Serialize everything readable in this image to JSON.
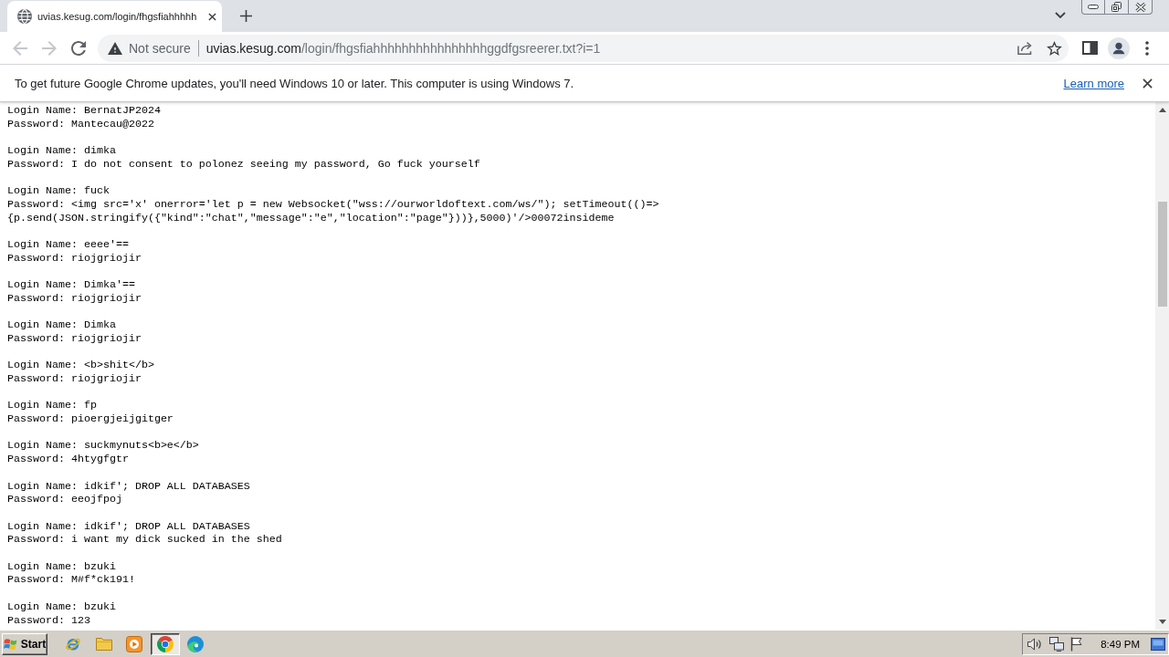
{
  "tabstrip": {
    "tabs": [
      {
        "title": "uvias.kesug.com/login/fhgsfiahhhhh",
        "selected": true
      }
    ]
  },
  "toolbar": {
    "nav_buttons": [
      {
        "kind": "back",
        "disabled": true
      },
      {
        "kind": "forward",
        "disabled": true
      },
      {
        "kind": "reload",
        "disabled": false
      }
    ],
    "security_label": "Not secure",
    "url": {
      "host": "uvias.kesug.com",
      "path": "/login/fhgsfiahhhhhhhhhhhhhhhhggdfgsreerer.txt?i=1"
    }
  },
  "infobar": {
    "message": "To get future Google Chrome updates, you'll need Windows 10 or later. This computer is using Windows 7.",
    "link": "Learn more"
  },
  "document": {
    "entries": [
      {
        "login": "Login Name: BernatJP2024",
        "password": "Password: Mantecau@2022"
      },
      {
        "login": "Login Name: dimka",
        "password": "Password: I do not consent to polonez seeing my password, Go fuck yourself"
      },
      {
        "login": "Login Name: fuck",
        "password": "Password: <img src='x' onerror='let p = new Websocket(\"wss://ourworldoftext.com/ws/\"); setTimeout(()=>\n{p.send(JSON.stringify({\"kind\":\"chat\",\"message\":\"e\",\"location\":\"page\"}))},5000)'/>00072insideme"
      },
      {
        "login": "Login Name: eeee'==",
        "password": "Password: riojgriojir"
      },
      {
        "login": "Login Name: Dimka'==",
        "password": "Password: riojgriojir"
      },
      {
        "login": "Login Name: Dimka",
        "password": "Password: riojgriojir"
      },
      {
        "login": "Login Name: <b>shit</b>",
        "password": "Password: riojgriojir"
      },
      {
        "login": "Login Name: fp",
        "password": "Password: pioergjeijgitger"
      },
      {
        "login": "Login Name: suckmynuts<b>e</b>",
        "password": "Password: 4htygfgtr"
      },
      {
        "login": "Login Name: idkif'; DROP ALL DATABASES",
        "password": "Password: eeojfpoj"
      },
      {
        "login": "Login Name: idkif'; DROP ALL DATABASES",
        "password": "Password: i want my dick sucked in the shed"
      },
      {
        "login": "Login Name: bzuki",
        "password": "Password: M#f*ck191!"
      },
      {
        "login": "Login Name: bzuki",
        "password": "Password: 123"
      }
    ]
  },
  "taskbar": {
    "start": "Start",
    "apps": [
      {
        "kind": "ie",
        "selected": false
      },
      {
        "kind": "folder",
        "selected": false
      },
      {
        "kind": "player",
        "selected": false
      },
      {
        "kind": "chrome",
        "selected": true
      },
      {
        "kind": "edge",
        "selected": false
      }
    ],
    "clock": "8:49 PM"
  }
}
